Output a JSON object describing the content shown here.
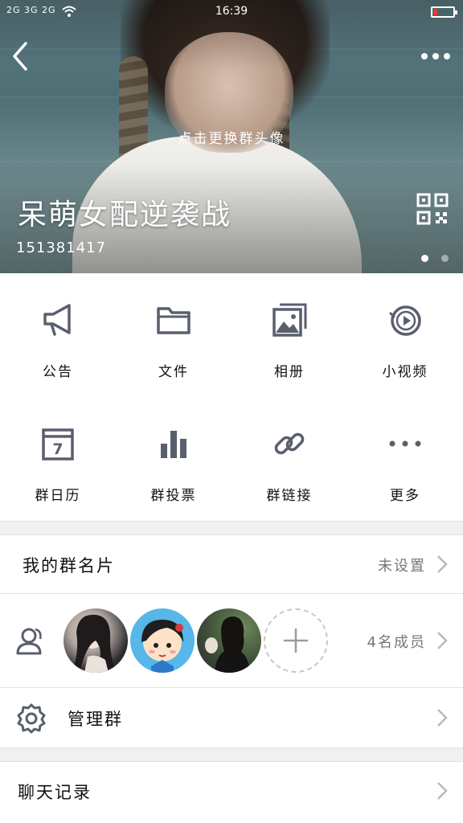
{
  "status": {
    "signal": "2G 3G 2G",
    "time": "16:39"
  },
  "header": {
    "cover_hint": "点击更换群头像",
    "group_name": "呆萌女配逆袭战",
    "group_id": "151381417"
  },
  "grid": [
    {
      "label": "公告",
      "icon": "megaphone-icon"
    },
    {
      "label": "文件",
      "icon": "folder-icon"
    },
    {
      "label": "相册",
      "icon": "photo-album-icon"
    },
    {
      "label": "小视频",
      "icon": "video-play-icon"
    },
    {
      "label": "群日历",
      "icon": "calendar-icon"
    },
    {
      "label": "群投票",
      "icon": "bar-chart-icon"
    },
    {
      "label": "群链接",
      "icon": "link-icon"
    },
    {
      "label": "更多",
      "icon": "more-dots-icon"
    }
  ],
  "calendar_day": "7",
  "card": {
    "title": "我的群名片",
    "value": "未设置"
  },
  "members": {
    "count_label": "4名成员"
  },
  "manage": {
    "title": "管理群"
  },
  "history": {
    "title": "聊天记录"
  },
  "colors": {
    "icon": "#5a5f6e",
    "divider": "#e2e2e4",
    "background_gap": "#f0f0f2"
  }
}
